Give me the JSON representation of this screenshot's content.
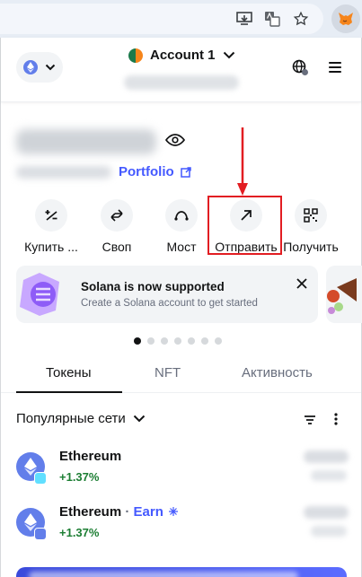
{
  "colors": {
    "accent": "#4459ff",
    "positive": "#1c7e33",
    "highlight": "#e21d22",
    "muted": "#686e7d"
  },
  "browser": {
    "icons": [
      "screen-cast-icon",
      "translate-icon",
      "bookmark-star-icon",
      "metamask-fox-icon"
    ]
  },
  "header": {
    "network_icon": "ethereum-icon",
    "account_name": "Account 1",
    "globe_icon": "globe-icon",
    "menu_icon": "hamburger-menu-icon"
  },
  "balance": {
    "portfolio_label": "Portfolio"
  },
  "actions": [
    {
      "label": "Купить ...",
      "icon": "buy-sell-icon"
    },
    {
      "label": "Своп",
      "icon": "swap-icon"
    },
    {
      "label": "Мост",
      "icon": "bridge-icon"
    },
    {
      "label": "Отправить",
      "icon": "send-arrow-icon"
    },
    {
      "label": "Получить",
      "icon": "qr-code-icon"
    }
  ],
  "banner": {
    "title": "Solana is now supported",
    "subtitle": "Create a Solana account to get started"
  },
  "carousel": {
    "dot_count": 7,
    "active_index": 0
  },
  "tabs": [
    {
      "label": "Токены",
      "active": true
    },
    {
      "label": "NFT",
      "active": false
    },
    {
      "label": "Активность",
      "active": false
    }
  ],
  "network_filter": {
    "label": "Популярные сети"
  },
  "tokens": [
    {
      "name": "Ethereum",
      "change": "+1.37%",
      "earn": ""
    },
    {
      "name": "Ethereum",
      "change": "+1.37%",
      "earn": "Earn"
    }
  ]
}
